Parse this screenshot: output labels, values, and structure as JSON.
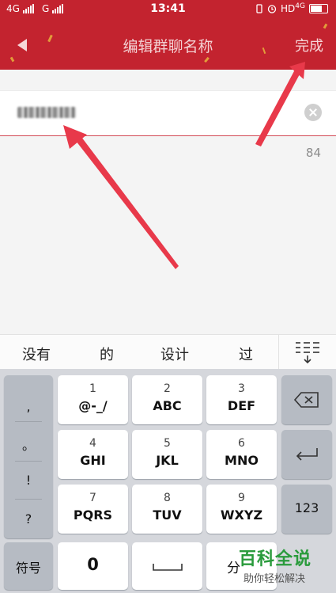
{
  "status_bar": {
    "network_left": "4G",
    "network_right": "G",
    "time": "13:41",
    "hd_label": "HD",
    "network_4g": "4G"
  },
  "nav": {
    "title": "编辑群聊名称",
    "done_label": "完成"
  },
  "editor": {
    "char_counter": "84"
  },
  "candidates": [
    "没有",
    "的",
    "设计",
    "过"
  ],
  "keyboard": {
    "punctuation": [
      ",",
      "。",
      "!",
      "?"
    ],
    "keys": [
      {
        "num": "1",
        "letters": "@-_/"
      },
      {
        "num": "2",
        "letters": "ABC"
      },
      {
        "num": "3",
        "letters": "DEF"
      },
      {
        "num": "4",
        "letters": "GHI"
      },
      {
        "num": "5",
        "letters": "JKL"
      },
      {
        "num": "6",
        "letters": "MNO"
      },
      {
        "num": "7",
        "letters": "PQRS"
      },
      {
        "num": "8",
        "letters": "TUV"
      },
      {
        "num": "9",
        "letters": "WXYZ"
      }
    ],
    "symbol_label": "符号",
    "zero_label": "0",
    "num_switch_label": "123",
    "space_key_partial": "分"
  },
  "watermark": {
    "main": "百科全说",
    "sub": "助你轻松解决"
  },
  "colors": {
    "header_red": "#c3232f",
    "annotation_arrow": "#e8394a",
    "underline": "#d24a55"
  }
}
